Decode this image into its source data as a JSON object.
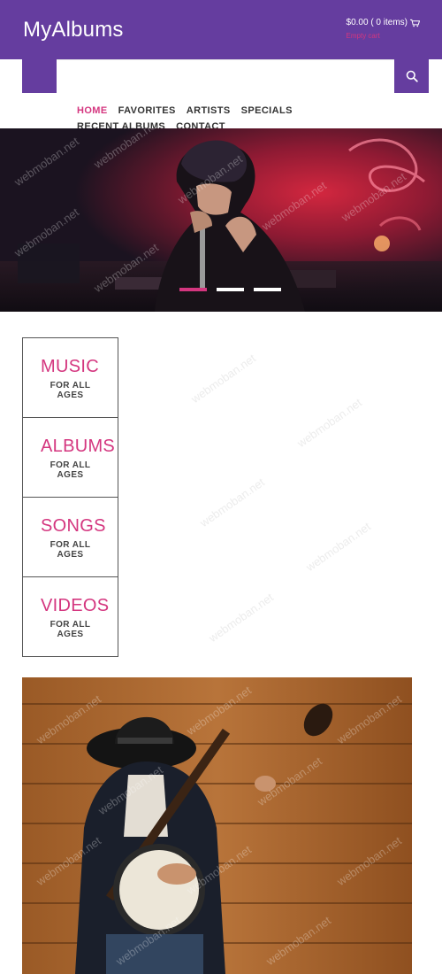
{
  "header": {
    "logo": "MyAlbums",
    "cart_summary": "$0.00 ( 0 items)",
    "cart_status": "Empty cart",
    "cart_icon": "shopping-cart-icon"
  },
  "search": {
    "value": "",
    "placeholder": "",
    "button_icon": "search-icon",
    "menu_icon": "menu-icon"
  },
  "nav": {
    "items": [
      {
        "label": "HOME",
        "active": true
      },
      {
        "label": "FAVORITES",
        "active": false
      },
      {
        "label": "ARTISTS",
        "active": false
      },
      {
        "label": "SPECIALS",
        "active": false
      },
      {
        "label": "RECENT ALBUMS",
        "active": false
      },
      {
        "label": "CONTACT",
        "active": false
      }
    ]
  },
  "hero": {
    "slides_count": 3,
    "active_slide": 1
  },
  "categories": [
    {
      "title": "MUSIC",
      "line1": "FOR ALL",
      "line2": "AGES"
    },
    {
      "title": "ALBUMS",
      "line1": "FOR ALL",
      "line2": "AGES"
    },
    {
      "title": "SONGS",
      "line1": "FOR ALL",
      "line2": "AGES"
    },
    {
      "title": "VIDEOS",
      "line1": "FOR ALL",
      "line2": "AGES"
    }
  ],
  "watermark": "webmoban.net",
  "colors": {
    "brand_purple": "#653d9f",
    "accent_pink": "#d4367f"
  }
}
